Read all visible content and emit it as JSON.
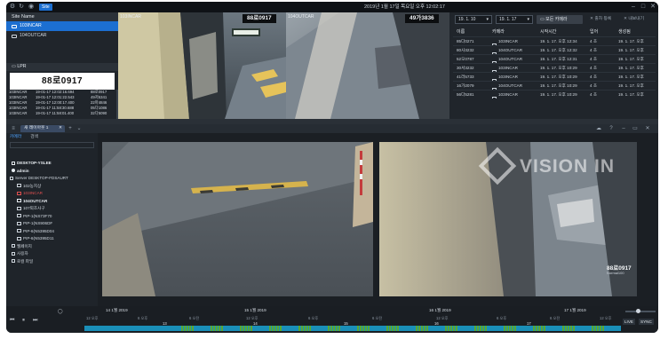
{
  "topbar": {
    "tag": "Site",
    "clock": "2019년 1월 17일 목요일 오후 12:02:17",
    "icons": [
      "settings-icon",
      "refresh-icon",
      "pin-icon",
      "minimize-icon",
      "maximize-icon",
      "close-icon"
    ]
  },
  "site_panel": {
    "header": "Site Name",
    "items": [
      {
        "label": "103INCAR",
        "selected": true
      },
      {
        "label": "104OUTCAR",
        "selected": false
      }
    ]
  },
  "lpr": {
    "header": "LPR",
    "plate": "88로0917",
    "rows": [
      [
        "103INCAR",
        "19-01-17 12:02:16.694",
        "88로0917"
      ],
      [
        "103INCAR",
        "19-01-17 12:01:22.543",
        "49저5341"
      ],
      [
        "103INCAR",
        "19-01-17 12:00:17.400",
        "22마4846"
      ],
      [
        "103INCAR",
        "19-01-17 11:58:30.688",
        "05다1086"
      ],
      [
        "103INCAR",
        "19-01-17 11:58:01.400",
        "32다5090"
      ]
    ]
  },
  "cam_top_left": {
    "label": "103INCAR",
    "plate": "88로0917"
  },
  "cam_top_right": {
    "label": "104OUTCAR",
    "plate": "49가3836"
  },
  "list_panel": {
    "date_from": "19. 1. 10",
    "date_to": "19. 1. 17",
    "filter_all": "모든 카메라",
    "action1": "출차 등록",
    "action2": "내보내기",
    "headers": [
      "이름",
      "카메라",
      "시작시간",
      "입어",
      "생성됨"
    ],
    "rows": [
      [
        "85다0271",
        "103INCAR",
        "19. 1. 17. 오후 12:34",
        "4 초",
        "19. 1. 17. 오후"
      ],
      [
        "80사3232",
        "104OUTCAR",
        "19. 1. 17. 오후 12:32",
        "4 초",
        "19. 1. 17. 오후"
      ],
      [
        "52오0787",
        "104OUTCAR",
        "19. 1. 17. 오후 12:31",
        "4 초",
        "19. 1. 17. 오후"
      ],
      [
        "30서3232",
        "103INCAR",
        "19. 1. 17. 오후 10:29",
        "4 초",
        "19. 1. 17. 오후"
      ],
      [
        "41러5733",
        "103INCAR",
        "19. 1. 17. 오후 10:29",
        "4 초",
        "19. 1. 17. 오후"
      ],
      [
        "16가2079",
        "104OUTCAR",
        "19. 1. 17. 오후 10:29",
        "4 초",
        "19. 1. 17. 오후"
      ],
      [
        "56다5281",
        "103INCAR",
        "19. 1. 17. 오후 10:29",
        "4 초",
        "19. 1. 17. 오후"
      ]
    ]
  },
  "bottom_toolbar": {
    "tab_label": "새 레이아웃 1",
    "icons": [
      "cloud-icon",
      "help-icon",
      "minimize-icon",
      "restore-icon",
      "close-icon"
    ]
  },
  "tree": {
    "tabs": [
      "카메라",
      "검색"
    ],
    "nodes": [
      {
        "label": "DESKTOP-YSLEE",
        "style": "bold",
        "icon": "pc",
        "indent": 6
      },
      {
        "label": "admin",
        "style": "bold",
        "icon": "user",
        "indent": 6
      },
      {
        "label": "Server DESKTOP-FDSAURT",
        "style": "normal",
        "icon": "server",
        "indent": 4
      },
      {
        "label": "102농지상",
        "style": "normal",
        "icon": "cam",
        "indent": 12
      },
      {
        "label": "103INCAR",
        "style": "red",
        "icon": "cam",
        "indent": 12
      },
      {
        "label": "104OUTCAR",
        "style": "bold",
        "icon": "cam",
        "indent": 12
      },
      {
        "label": "107퇴조사구",
        "style": "normal",
        "icon": "cam",
        "indent": 12
      },
      {
        "label": "PIP-1(NS73F70",
        "style": "normal",
        "icon": "cam",
        "indent": 12
      },
      {
        "label": "PIP-1(NS906DF",
        "style": "normal",
        "icon": "cam",
        "indent": 12
      },
      {
        "label": "PIP-6(N5395D04",
        "style": "normal",
        "icon": "cam",
        "indent": 12
      },
      {
        "label": "PIP-6(N5395D11",
        "style": "normal",
        "icon": "cam",
        "indent": 12
      },
      {
        "label": "웹페이지",
        "style": "normal",
        "icon": "box",
        "indent": 6
      },
      {
        "label": "사용자",
        "style": "normal",
        "icon": "box",
        "indent": 6
      },
      {
        "label": "로컬 파일",
        "style": "normal",
        "icon": "box",
        "indent": 6
      }
    ]
  },
  "cam_bot_right": {
    "watermark": "VISION IN",
    "plate": "88로0917",
    "plate_sub": "Normal100"
  },
  "timeline": {
    "days": [
      "14 1월 2019",
      "15 1월 2019",
      "16 1월 2019",
      "17 1월 2019"
    ],
    "hour_labels": [
      "12 오후",
      "6 오후",
      "6 오전",
      "12 오후",
      "6 오후",
      "6 오전",
      "12 오후",
      "6 오후",
      "6 오전",
      "12 오후"
    ],
    "hour_numbers": [
      "13",
      "14",
      "15",
      "16",
      "17"
    ],
    "live": "LIVE",
    "sync": "SYNC",
    "accent": "#1a8fb8",
    "record_color": "#5aa832"
  }
}
